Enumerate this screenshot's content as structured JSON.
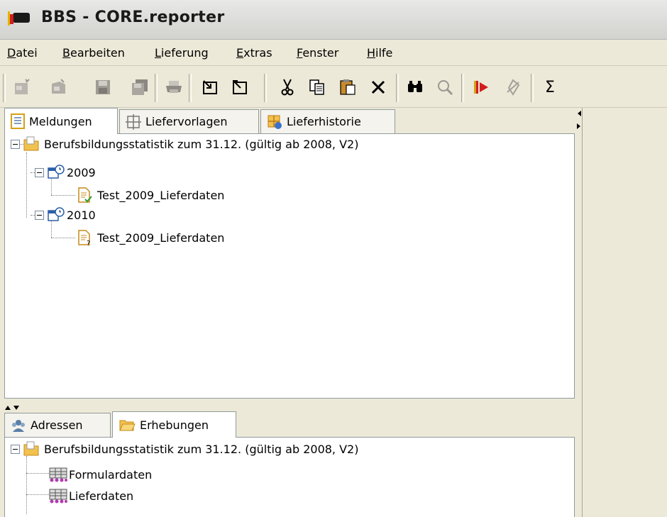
{
  "window": {
    "title": "BBS - CORE.reporter"
  },
  "menu": [
    {
      "pre": "",
      "u": "D",
      "post": "atei"
    },
    {
      "pre": "",
      "u": "B",
      "post": "earbeiten"
    },
    {
      "pre": "",
      "u": "L",
      "post": "ieferung"
    },
    {
      "pre": "",
      "u": "E",
      "post": "xtras"
    },
    {
      "pre": "",
      "u": "F",
      "post": "enster"
    },
    {
      "pre": "",
      "u": "H",
      "post": "ilfe"
    }
  ],
  "toolbar": {
    "sigma": "Σ",
    "icons": [
      "new-document-icon",
      "open-document-icon",
      "save-icon",
      "save-all-icon",
      "print-icon",
      "import-icon",
      "export-icon",
      "cut-icon",
      "copy-icon",
      "paste-icon",
      "delete-icon",
      "find-icon",
      "search-icon",
      "send-icon",
      "validate-icon",
      "sum-icon"
    ]
  },
  "top_panel": {
    "tabs": [
      "Meldungen",
      "Liefervorlagen",
      "Lieferhistorie"
    ],
    "tree": {
      "root": "Berufsbildungsstatistik zum 31.12. (gültig ab 2008, V2)",
      "years": [
        {
          "label": "2009",
          "child": "Test_2009_Lieferdaten",
          "status": "ok"
        },
        {
          "label": "2010",
          "child": "Test_2009_Lieferdaten",
          "status": "unknown"
        }
      ]
    }
  },
  "bottom_panel": {
    "tabs": [
      "Adressen",
      "Erhebungen"
    ],
    "tree": {
      "root": "Berufsbildungsstatistik zum 31.12. (gültig ab 2008, V2)",
      "children": [
        "Formulardaten",
        "Lieferdaten"
      ]
    }
  },
  "colors": {
    "accent": "#d4a017",
    "folder": "#f2c24f",
    "check": "#2e9c2e",
    "table": "#b03cb0"
  }
}
